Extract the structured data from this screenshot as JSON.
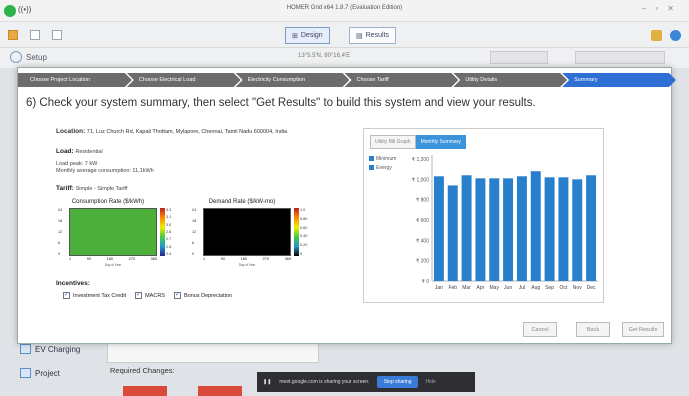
{
  "window": {
    "title": "HOMER Grid x64 1.8.7 (Evaluation Edition)"
  },
  "toolbar": {
    "design_label": "Design",
    "results_label": "Results"
  },
  "subbar": {
    "setup_label": "Setup",
    "coordinates": "13°5.5'N, 80°16.4'E"
  },
  "wizard": {
    "steps": [
      "Choose Project Location",
      "Choose Electrical Load",
      "Electricity Consumption",
      "Choose Tariff",
      "Utility Details",
      "Summary"
    ],
    "active_step": 5,
    "heading": "6) Check your system summary, then select \"Get Results\" to build this system and view your results.",
    "location_label": "Location:",
    "location_value": "71, Luz Church Rd, Kapali Thottam, Mylapore, Chennai, Tamil Nadu 600004, India",
    "load_label": "Load:",
    "load_value": "Residential",
    "load_peak": "Load peak: 7 kW",
    "load_monthly": "Monthly average consumption: 11,1kWh",
    "tariff_label": "Tariff:",
    "tariff_value": "Simple - Simple Tariff",
    "consumption_title": "Consumption Rate ($/kWh)",
    "demand_title": "Demand Rate ($/kW-mo)",
    "hour_ticks": [
      "0",
      "6",
      "12",
      "18",
      "24"
    ],
    "day_ticks": [
      "1",
      "90",
      "180",
      "270",
      "365"
    ],
    "xlabel": "Day of Year",
    "consumption_scale": [
      "3.3",
      "3.1",
      "3.0",
      "2.8",
      "2.7",
      "2.5",
      "2.4"
    ],
    "demand_scale": [
      "1.0",
      "0.80",
      "0.60",
      "0.40",
      "0.20",
      "0"
    ],
    "incentives_label": "Incentives:",
    "incentives": [
      "Investment Tax Credit",
      "MACRS",
      "Bonus Depreciation"
    ],
    "buttons": {
      "cancel": "Cancel",
      "back": "Back",
      "get_results": "Get Results"
    }
  },
  "summary_tabs": [
    "Utility Bill Graph",
    "Monthly Summary"
  ],
  "summary_legend": [
    "Minimum",
    "Energy"
  ],
  "chart_data": {
    "type": "bar",
    "categories": [
      "Jan",
      "Feb",
      "Mar",
      "Apr",
      "May",
      "Jun",
      "Jul",
      "Aug",
      "Sep",
      "Oct",
      "Nov",
      "Dec"
    ],
    "series": [
      {
        "name": "Energy",
        "values": [
          1030,
          940,
          1040,
          1010,
          1010,
          1010,
          1030,
          1080,
          1020,
          1020,
          1000,
          1040
        ]
      }
    ],
    "yticks": [
      "₹ 1,200",
      "₹ 1,000",
      "₹ 800",
      "₹ 600",
      "₹ 400",
      "₹ 200",
      "₹ 0"
    ],
    "ylim": [
      0,
      1200
    ],
    "color": "#2880cc"
  },
  "sidebar": {
    "ev_label": "EV Charging",
    "project_label": "Project"
  },
  "bottom": {
    "required_changes": "Required Changes:"
  },
  "share_bar": {
    "text": "meet.google.com is sharing your screen.",
    "stop": "Stop sharing",
    "hide": "Hide"
  }
}
